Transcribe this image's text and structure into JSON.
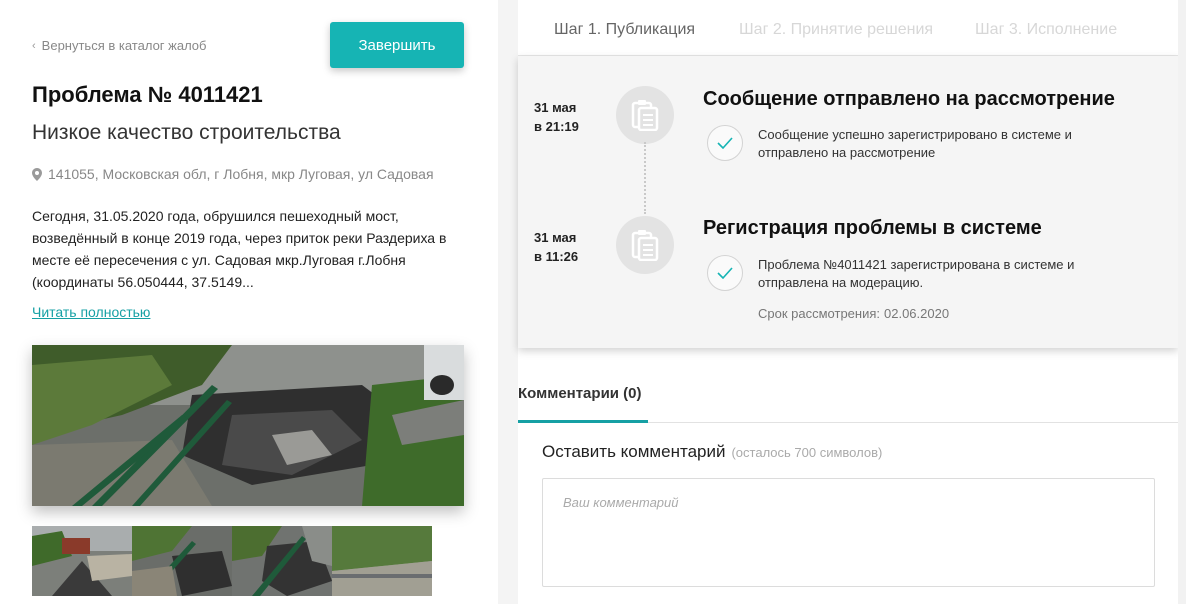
{
  "left": {
    "back_link": "Вернуться в каталог жалоб",
    "finish_button": "Завершить",
    "problem_number": "Проблема № 4011421",
    "category": "Низкое качество строительства",
    "address": "141055, Московская обл, г Лобня, мкр Луговая, ул Садовая",
    "description": "Сегодня, 31.05.2020 года, обрушился пешеходный мост, возведённый в конце 2019 года, через приток реки Раздериха в месте её пересечения с ул. Садовая мкр.Луговая г.Лобня (координаты 56.050444, 37.5149...",
    "read_more": "Читать полностью"
  },
  "steps": [
    {
      "label": "Шаг 1. Публикация",
      "state": "active"
    },
    {
      "label": "Шаг 2. Принятие решения",
      "state": "inactive"
    },
    {
      "label": "Шаг 3. Исполнение",
      "state": "inactive"
    }
  ],
  "timeline": [
    {
      "date_line1": "31 мая",
      "date_line2": "в 21:19",
      "title": "Сообщение отправлено на рассмотрение",
      "text": "Сообщение успешно зарегистрировано в системе и отправлено на рассмотрение"
    },
    {
      "date_line1": "31 мая",
      "date_line2": "в 11:26",
      "title": "Регистрация проблемы в системе",
      "text": "Проблема №4011421 зарегистрирована в системе и отправлена на модерацию.",
      "deadline_label": "Срок рассмотрения:",
      "deadline_value": "02.06.2020"
    }
  ],
  "comments": {
    "tab_label": "Комментарии (0)",
    "leave_title": "Оставить комментарий",
    "chars_left": "(осталось 700 символов)",
    "placeholder": "Ваш комментарий"
  },
  "colors": {
    "accent": "#16b4b4",
    "link": "#16a0a4",
    "timeline_bg": "#f5f5f5"
  },
  "icons": {
    "back": "chevron-left-icon",
    "address": "location-pin-icon",
    "event": "clipboard-icon",
    "check": "checkmark-icon"
  }
}
